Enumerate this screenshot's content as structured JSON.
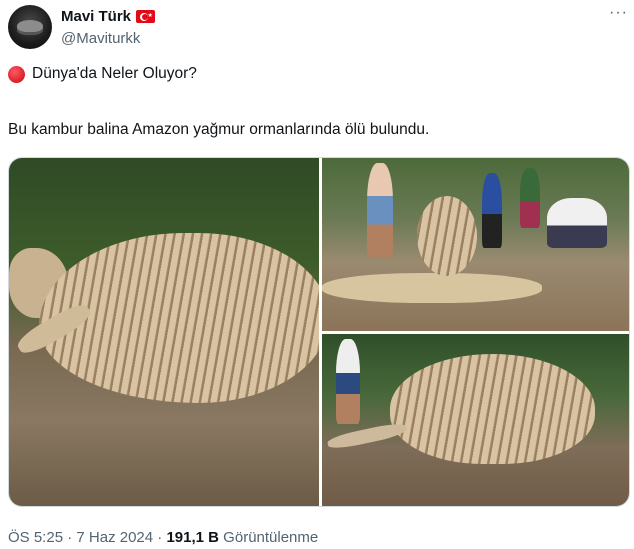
{
  "author": {
    "display_name": "Mavi Türk",
    "handle": "@Maviturkk"
  },
  "tweet": {
    "line1": "Dünya'da Neler Oluyor?",
    "line2": "Bu kambur balina Amazon yağmur ormanlarında ölü bulundu."
  },
  "media": {
    "count": 3
  },
  "meta": {
    "time": "ÖS 5:25",
    "sep1": " · ",
    "date": "7 Haz 2024",
    "sep2": " · ",
    "views_count": "191,1 B",
    "views_label": " Görüntülenme"
  },
  "icons": {
    "more": "more-horizontal-icon",
    "flag": "turkey-flag-icon",
    "dot": "red-circle-emoji-icon"
  },
  "colors": {
    "text": "#0f1419",
    "secondary": "#536471",
    "border": "#cfd9de"
  }
}
